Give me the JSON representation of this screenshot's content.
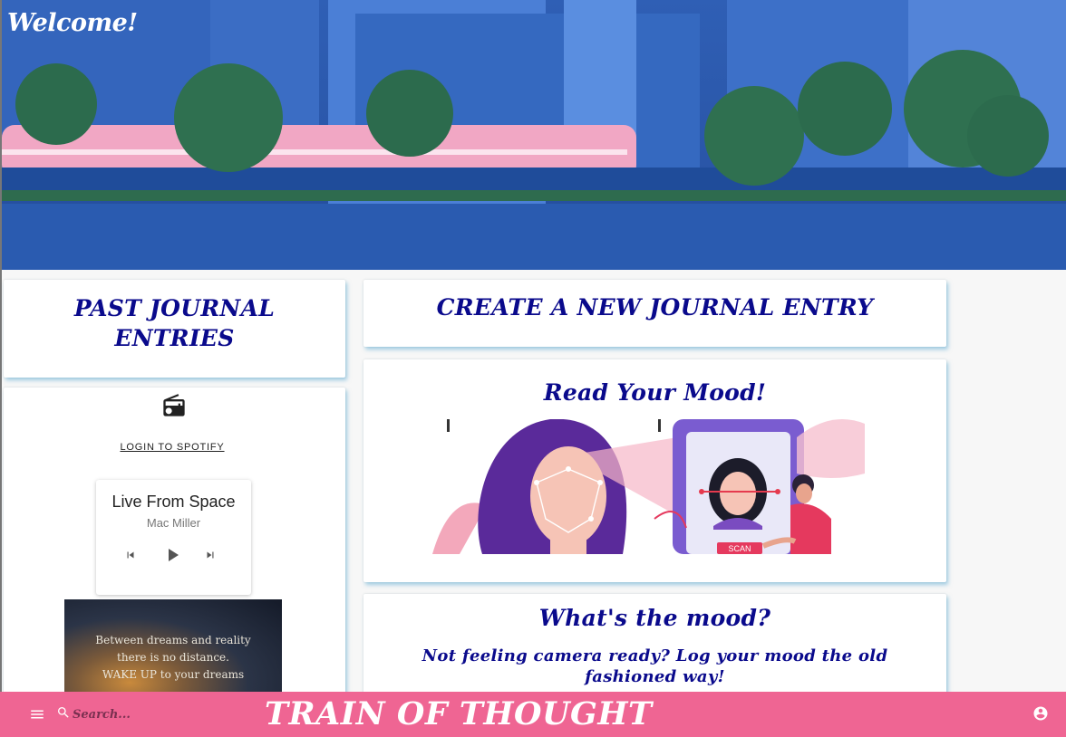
{
  "hero": {
    "welcome": "Welcome!"
  },
  "past_entries": {
    "title": "PAST JOURNAL ENTRIES"
  },
  "spotify": {
    "login_label": "LOGIN TO SPOTIFY",
    "player": {
      "song": "Live From Space",
      "artist": "Mac Miller"
    }
  },
  "quote": {
    "line1": "Between dreams and reality",
    "line2": "there is no distance.",
    "line3": "WAKE UP to your dreams"
  },
  "create_entry": {
    "title": "CREATE A NEW JOURNAL ENTRY"
  },
  "mood_reader": {
    "title": "Read Your Mood!",
    "scan_label": "SCAN"
  },
  "manual_mood": {
    "title": "What's the mood?",
    "subtitle": "Not feeling camera ready? Log your mood the old fashioned way!"
  },
  "footer": {
    "search_placeholder": "Search...",
    "brand": "TRAIN OF THOUGHT"
  },
  "colors": {
    "accent": "#ef6593",
    "heading": "#0a0a8c",
    "hero": "#2a56a8"
  }
}
